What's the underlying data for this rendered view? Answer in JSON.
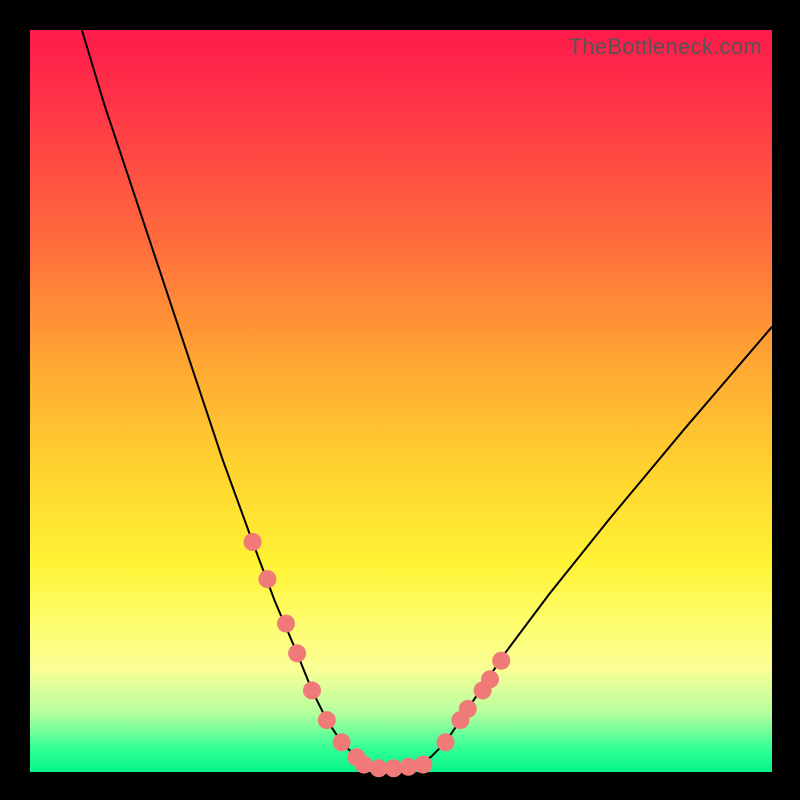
{
  "watermark": "TheBottleneck.com",
  "colors": {
    "frame": "#000000",
    "curve": "#000000",
    "dots": "#ef7a78",
    "gradient_stops": [
      "#ff1a4b",
      "#ff3a46",
      "#ff6a3c",
      "#ffa733",
      "#ffd52f",
      "#fff335",
      "#fdfe6e",
      "#fbfe95",
      "#b6ff9e",
      "#2fff95",
      "#08f38a"
    ]
  },
  "chart_data": {
    "type": "line",
    "title": "",
    "xlabel": "",
    "ylabel": "",
    "xlim": [
      0,
      100
    ],
    "ylim": [
      0,
      100
    ],
    "curve": {
      "x": [
        7,
        10,
        14,
        18,
        22,
        26,
        30,
        33,
        36,
        38,
        40,
        42,
        44,
        46,
        48,
        50,
        52,
        54,
        56,
        58,
        60,
        64,
        70,
        78,
        88,
        100
      ],
      "y": [
        100,
        90,
        78,
        66,
        54,
        42,
        31,
        23,
        16,
        11,
        7,
        4,
        2,
        1,
        0.5,
        0.5,
        1,
        2,
        4,
        7,
        10,
        16,
        24,
        34,
        46,
        60
      ]
    },
    "markers_left": {
      "x": [
        30,
        32,
        34.5,
        36,
        38,
        40,
        42,
        44
      ],
      "y": [
        31,
        26,
        20,
        16,
        11,
        7,
        4,
        2
      ]
    },
    "markers_bottom": {
      "x": [
        45,
        47,
        49,
        51,
        53
      ],
      "y": [
        1,
        0.5,
        0.5,
        0.7,
        1
      ]
    },
    "markers_right": {
      "x": [
        56,
        58,
        59,
        61,
        62,
        63.5
      ],
      "y": [
        4,
        7,
        8.5,
        11,
        12.5,
        15
      ]
    },
    "note": "Axes are unlabeled in the source image; x and y are normalized 0–100 to the plot area. y=0 is the bottom (green), y=100 is the top (red)."
  }
}
